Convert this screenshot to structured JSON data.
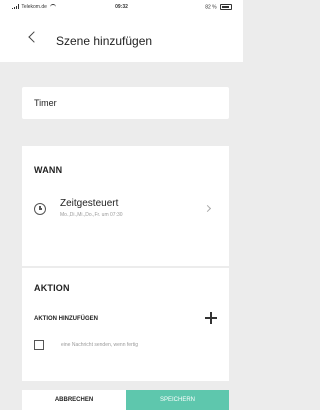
{
  "status_bar": {
    "carrier": "Telekom.de",
    "time": "09:32",
    "battery": "82 %",
    "icons": [
      "signal-icon",
      "wifi-icon",
      "battery-icon"
    ]
  },
  "header": {
    "title": "Szene hinzufügen",
    "back_icon": "chevron-left-icon"
  },
  "name_field": {
    "value": "Timer"
  },
  "when_section": {
    "label": "WANN",
    "schedule_title": "Zeitgesteuert",
    "schedule_detail": "Mo.,Di.,Mi.,Do.,Fr. um 07:30",
    "icon": "clock-icon"
  },
  "action_section": {
    "label": "AKTION",
    "add_action_label": "AKTION HINZUFÜGEN",
    "notify_label": "eine Nachricht senden, wenn fertig",
    "notify_checked": false
  },
  "footer": {
    "cancel_label": "ABBRECHEN",
    "save_label": "SPEICHERN"
  },
  "colors": {
    "background": "#ececec",
    "accent": "#5ec7ad"
  }
}
